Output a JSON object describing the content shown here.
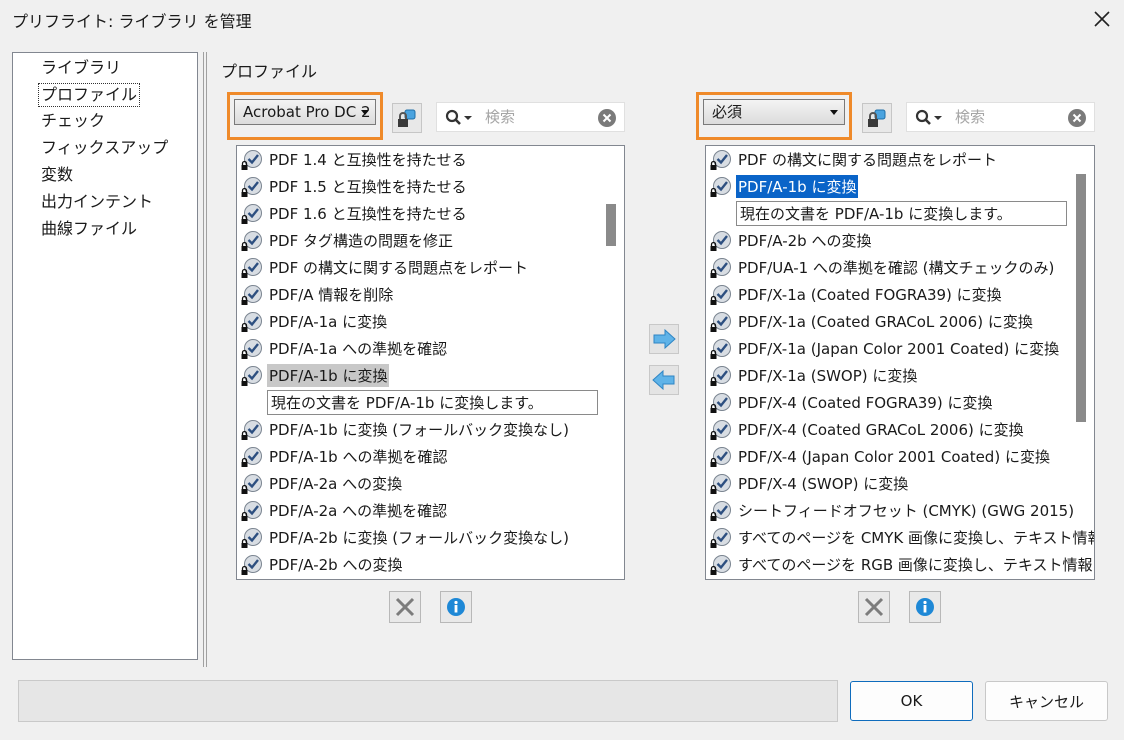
{
  "window": {
    "title": "プリフライト: ライブラリ を管理"
  },
  "sidebar": {
    "items": [
      {
        "label": "ライブラリ"
      },
      {
        "label": "プロファイル"
      },
      {
        "label": "チェック"
      },
      {
        "label": "フィックスアップ"
      },
      {
        "label": "変数"
      },
      {
        "label": "出力インテント"
      },
      {
        "label": "曲線ファイル"
      }
    ],
    "selected": "プロファイル"
  },
  "main": {
    "section_label": "プロファイル",
    "left_panel": {
      "dropdown_value": "Acrobat Pro DC 2",
      "search_placeholder": "検索",
      "items": [
        {
          "label": "PDF 1.4 と互換性を持たせる"
        },
        {
          "label": "PDF 1.5 と互換性を持たせる"
        },
        {
          "label": "PDF 1.6 と互換性を持たせる"
        },
        {
          "label": "PDF タグ構造の問題を修正"
        },
        {
          "label": "PDF の構文に関する問題点をレポート"
        },
        {
          "label": "PDF/A 情報を削除"
        },
        {
          "label": "PDF/A-1a に変換"
        },
        {
          "label": "PDF/A-1a への準拠を確認"
        },
        {
          "label": "PDF/A-1b に変換"
        },
        {
          "label": "PDF/A-1b に変換 (フォールバック変換なし)"
        },
        {
          "label": "PDF/A-1b への準拠を確認"
        },
        {
          "label": "PDF/A-2a への変換"
        },
        {
          "label": "PDF/A-2a への準拠を確認"
        },
        {
          "label": "PDF/A-2b に変換 (フォールバック変換なし)"
        },
        {
          "label": "PDF/A-2b への変換"
        }
      ],
      "selected_description": "現在の文書を PDF/A-1b に変換します。"
    },
    "right_panel": {
      "dropdown_value": "必須",
      "search_placeholder": "検索",
      "items": [
        {
          "label": "PDF の構文に関する問題点をレポート"
        },
        {
          "label": "PDF/A-1b に変換"
        },
        {
          "label": "PDF/A-2b への変換"
        },
        {
          "label": "PDF/UA-1 への準拠を確認 (構文チェックのみ)"
        },
        {
          "label": "PDF/X-1a (Coated FOGRA39) に変換"
        },
        {
          "label": "PDF/X-1a (Coated GRACoL 2006) に変換"
        },
        {
          "label": "PDF/X-1a (Japan Color 2001 Coated) に変換"
        },
        {
          "label": "PDF/X-1a (SWOP) に変換"
        },
        {
          "label": "PDF/X-4 (Coated FOGRA39) に変換"
        },
        {
          "label": "PDF/X-4 (Coated GRACoL 2006) に変換"
        },
        {
          "label": "PDF/X-4 (Japan Color 2001 Coated) に変換"
        },
        {
          "label": "PDF/X-4 (SWOP) に変換"
        },
        {
          "label": "シートフィードオフセット (CMYK) (GWG 2015)"
        },
        {
          "label": "すべてのページを CMYK 画像に変換し、テキスト情報"
        },
        {
          "label": "すべてのページを RGB 画像に変換し、テキスト情報"
        }
      ],
      "selected_description": "現在の文書を PDF/A-1b に変換します。"
    }
  },
  "footer": {
    "ok_label": "OK",
    "cancel_label": "キャンセル"
  },
  "colors": {
    "highlight_orange": "#ef8a2a",
    "selection_blue": "#0a64c8",
    "selection_grey": "#c8c8c8"
  }
}
